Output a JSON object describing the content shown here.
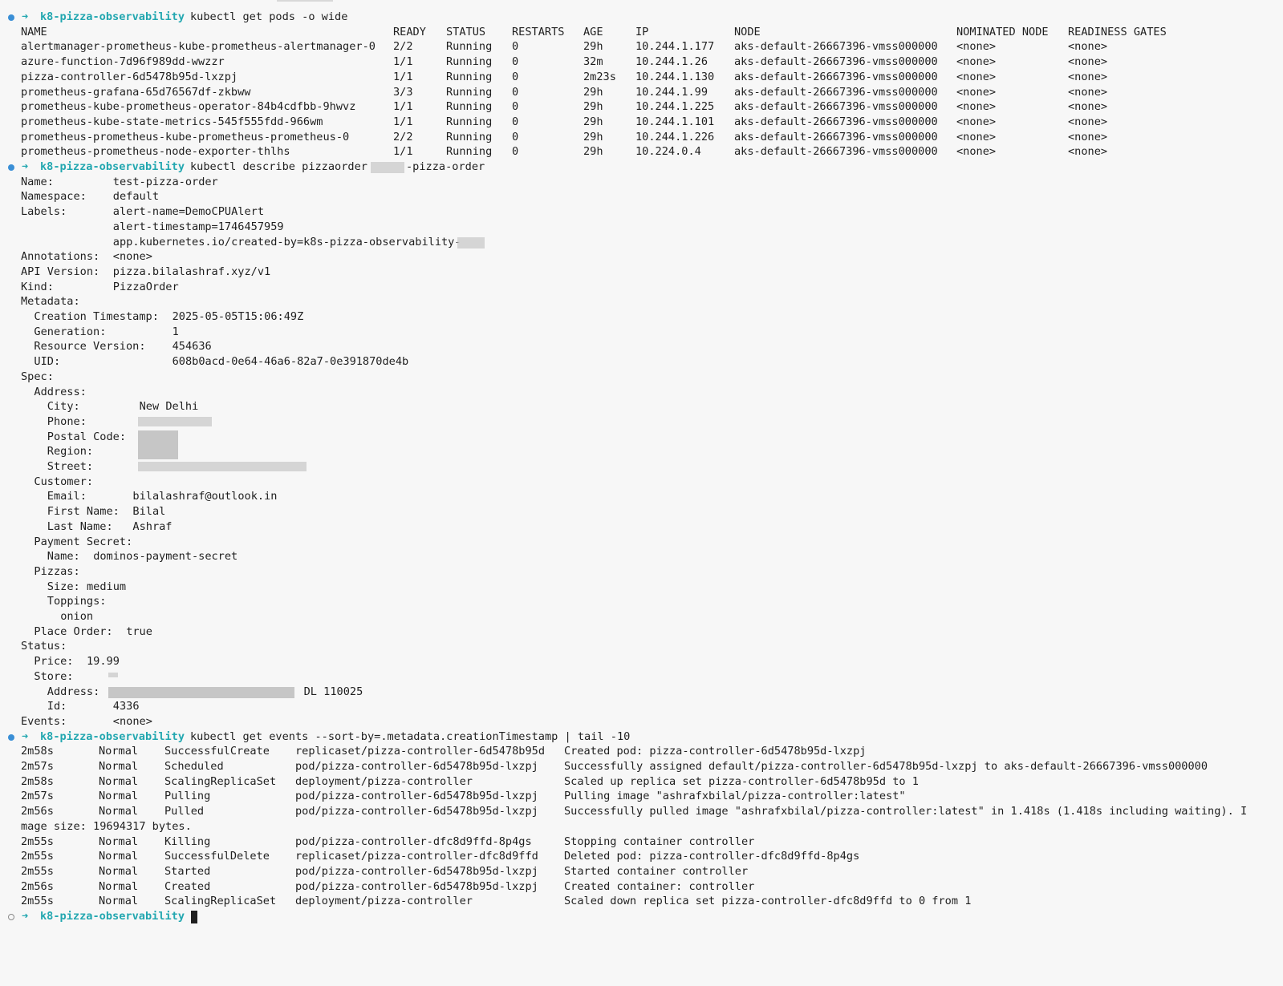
{
  "prompt": {
    "arrow": "➜",
    "dir": "k8-pizza-observability"
  },
  "commands": {
    "get_pods": "kubectl get pods -o wide",
    "describe": "kubectl describe pizzaorder ",
    "describe_suffix": "-pizza-order",
    "get_events": "kubectl get events --sort-by=.metadata.creationTimestamp | tail -10"
  },
  "pods": {
    "headers": [
      "NAME",
      "READY",
      "STATUS",
      "RESTARTS",
      "AGE",
      "IP",
      "NODE",
      "NOMINATED NODE",
      "READINESS GATES"
    ],
    "rows": [
      [
        "alertmanager-prometheus-kube-prometheus-alertmanager-0",
        "2/2",
        "Running",
        "0",
        "29h",
        "10.244.1.177",
        "aks-default-26667396-vmss000000",
        "<none>",
        "<none>"
      ],
      [
        "azure-function-7d96f989dd-wwzzr",
        "1/1",
        "Running",
        "0",
        "32m",
        "10.244.1.26",
        "aks-default-26667396-vmss000000",
        "<none>",
        "<none>"
      ],
      [
        "pizza-controller-6d5478b95d-lxzpj",
        "1/1",
        "Running",
        "0",
        "2m23s",
        "10.244.1.130",
        "aks-default-26667396-vmss000000",
        "<none>",
        "<none>"
      ],
      [
        "prometheus-grafana-65d76567df-zkbww",
        "3/3",
        "Running",
        "0",
        "29h",
        "10.244.1.99",
        "aks-default-26667396-vmss000000",
        "<none>",
        "<none>"
      ],
      [
        "prometheus-kube-prometheus-operator-84b4cdfbb-9hwvz",
        "1/1",
        "Running",
        "0",
        "29h",
        "10.244.1.225",
        "aks-default-26667396-vmss000000",
        "<none>",
        "<none>"
      ],
      [
        "prometheus-kube-state-metrics-545f555fdd-966wm",
        "1/1",
        "Running",
        "0",
        "29h",
        "10.244.1.101",
        "aks-default-26667396-vmss000000",
        "<none>",
        "<none>"
      ],
      [
        "prometheus-prometheus-kube-prometheus-prometheus-0",
        "2/2",
        "Running",
        "0",
        "29h",
        "10.244.1.226",
        "aks-default-26667396-vmss000000",
        "<none>",
        "<none>"
      ],
      [
        "prometheus-prometheus-node-exporter-thlhs",
        "1/1",
        "Running",
        "0",
        "29h",
        "10.224.0.4",
        "aks-default-26667396-vmss000000",
        "<none>",
        "<none>"
      ]
    ]
  },
  "describe": {
    "lines": [
      {
        "k": "Name:",
        "v": "test-pizza-order",
        "ki": 0,
        "vi": 14
      },
      {
        "k": "Namespace:",
        "v": "default",
        "ki": 0,
        "vi": 14
      },
      {
        "k": "Labels:",
        "v": "alert-name=DemoCPUAlert",
        "ki": 0,
        "vi": 14
      },
      {
        "k": "",
        "v": "alert-timestamp=1746457959",
        "ki": 0,
        "vi": 14
      },
      {
        "k": "",
        "v": "app.kubernetes.io/created-by=k8s-pizza-observability-",
        "ki": 0,
        "vi": 14
      },
      {
        "k": "Annotations:",
        "v": "<none>",
        "ki": 0,
        "vi": 14
      },
      {
        "k": "API Version:",
        "v": "pizza.bilalashraf.xyz/v1",
        "ki": 0,
        "vi": 14
      },
      {
        "k": "Kind:",
        "v": "PizzaOrder",
        "ki": 0,
        "vi": 14
      },
      {
        "k": "Metadata:",
        "v": "",
        "ki": 0,
        "vi": 14
      },
      {
        "k": "Creation Timestamp:",
        "v": "2025-05-05T15:06:49Z",
        "ki": 2,
        "vi": 23
      },
      {
        "k": "Generation:",
        "v": "1",
        "ki": 2,
        "vi": 23
      },
      {
        "k": "Resource Version:",
        "v": "454636",
        "ki": 2,
        "vi": 23
      },
      {
        "k": "UID:",
        "v": "608b0acd-0e64-46a6-82a7-0e391870de4b",
        "ki": 2,
        "vi": 23
      },
      {
        "k": "Spec:",
        "v": "",
        "ki": 0,
        "vi": 14
      },
      {
        "k": "Address:",
        "v": "",
        "ki": 2,
        "vi": 14
      },
      {
        "k": "City:",
        "v": "New Delhi",
        "ki": 4,
        "vi": 18
      },
      {
        "k": "Phone:",
        "v": "",
        "ki": 4,
        "vi": 18
      },
      {
        "k": "Postal Code:",
        "v": "",
        "ki": 4,
        "vi": 18
      },
      {
        "k": "Region:",
        "v": "",
        "ki": 4,
        "vi": 18
      },
      {
        "k": "Street:",
        "v": "",
        "ki": 4,
        "vi": 18
      },
      {
        "k": "Customer:",
        "v": "",
        "ki": 2,
        "vi": 14
      },
      {
        "k": "Email:",
        "v": "bilalashraf@outlook.in",
        "ki": 4,
        "vi": 17
      },
      {
        "k": "First Name:",
        "v": "Bilal",
        "ki": 4,
        "vi": 17
      },
      {
        "k": "Last Name:",
        "v": "Ashraf",
        "ki": 4,
        "vi": 17
      },
      {
        "k": "Payment Secret:",
        "v": "",
        "ki": 2,
        "vi": 14
      },
      {
        "k": "Name:",
        "v": "dominos-payment-secret",
        "ki": 4,
        "vi": 11
      },
      {
        "k": "Pizzas:",
        "v": "",
        "ki": 2,
        "vi": 14
      },
      {
        "k": "Size:",
        "v": "medium",
        "ki": 4,
        "vi": 10
      },
      {
        "k": "Toppings:",
        "v": "",
        "ki": 4,
        "vi": 14
      },
      {
        "k": "onion",
        "v": "",
        "ki": 6,
        "vi": 14
      },
      {
        "k": "Place Order:",
        "v": "true",
        "ki": 2,
        "vi": 16
      },
      {
        "k": "Status:",
        "v": "",
        "ki": 0,
        "vi": 14
      },
      {
        "k": "Price:",
        "v": "19.99",
        "ki": 2,
        "vi": 10
      },
      {
        "k": "Store:",
        "v": "",
        "ki": 2,
        "vi": 14
      },
      {
        "k": "Address:",
        "v": "DL 110025",
        "ki": 4,
        "vi": 43
      },
      {
        "k": "Id:",
        "v": "4336",
        "ki": 4,
        "vi": 14
      },
      {
        "k": "Events:",
        "v": "<none>",
        "ki": 0,
        "vi": 14
      }
    ]
  },
  "events": {
    "rows": [
      [
        "2m58s",
        "Normal",
        "SuccessfulCreate",
        "replicaset/pizza-controller-6d5478b95d",
        "Created pod: pizza-controller-6d5478b95d-lxzpj"
      ],
      [
        "2m57s",
        "Normal",
        "Scheduled",
        "pod/pizza-controller-6d5478b95d-lxzpj",
        "Successfully assigned default/pizza-controller-6d5478b95d-lxzpj to aks-default-26667396-vmss000000"
      ],
      [
        "2m58s",
        "Normal",
        "ScalingReplicaSet",
        "deployment/pizza-controller",
        "Scaled up replica set pizza-controller-6d5478b95d to 1"
      ],
      [
        "2m57s",
        "Normal",
        "Pulling",
        "pod/pizza-controller-6d5478b95d-lxzpj",
        "Pulling image \"ashrafxbilal/pizza-controller:latest\""
      ],
      [
        "2m56s",
        "Normal",
        "Pulled",
        "pod/pizza-controller-6d5478b95d-lxzpj",
        "Successfully pulled image \"ashrafxbilal/pizza-controller:latest\" in 1.418s (1.418s including waiting). I"
      ],
      [
        "",
        "",
        "",
        "",
        ""
      ],
      [
        "2m55s",
        "Normal",
        "Killing",
        "pod/pizza-controller-dfc8d9ffd-8p4gs",
        "Stopping container controller"
      ],
      [
        "2m55s",
        "Normal",
        "SuccessfulDelete",
        "replicaset/pizza-controller-dfc8d9ffd",
        "Deleted pod: pizza-controller-dfc8d9ffd-8p4gs"
      ],
      [
        "2m55s",
        "Normal",
        "Started",
        "pod/pizza-controller-6d5478b95d-lxzpj",
        "Started container controller"
      ],
      [
        "2m56s",
        "Normal",
        "Created",
        "pod/pizza-controller-6d5478b95d-lxzpj",
        "Created container: controller"
      ],
      [
        "2m55s",
        "Normal",
        "ScalingReplicaSet",
        "deployment/pizza-controller",
        "Scaled down replica set pizza-controller-dfc8d9ffd to 0 from 1"
      ]
    ],
    "wrap_line": "mage size: 19694317 bytes."
  },
  "colors": {
    "background": "#f7f7f7",
    "text": "#1f1f1f",
    "prompt": "#23a7b0",
    "bullet": "#3a8fd6"
  }
}
